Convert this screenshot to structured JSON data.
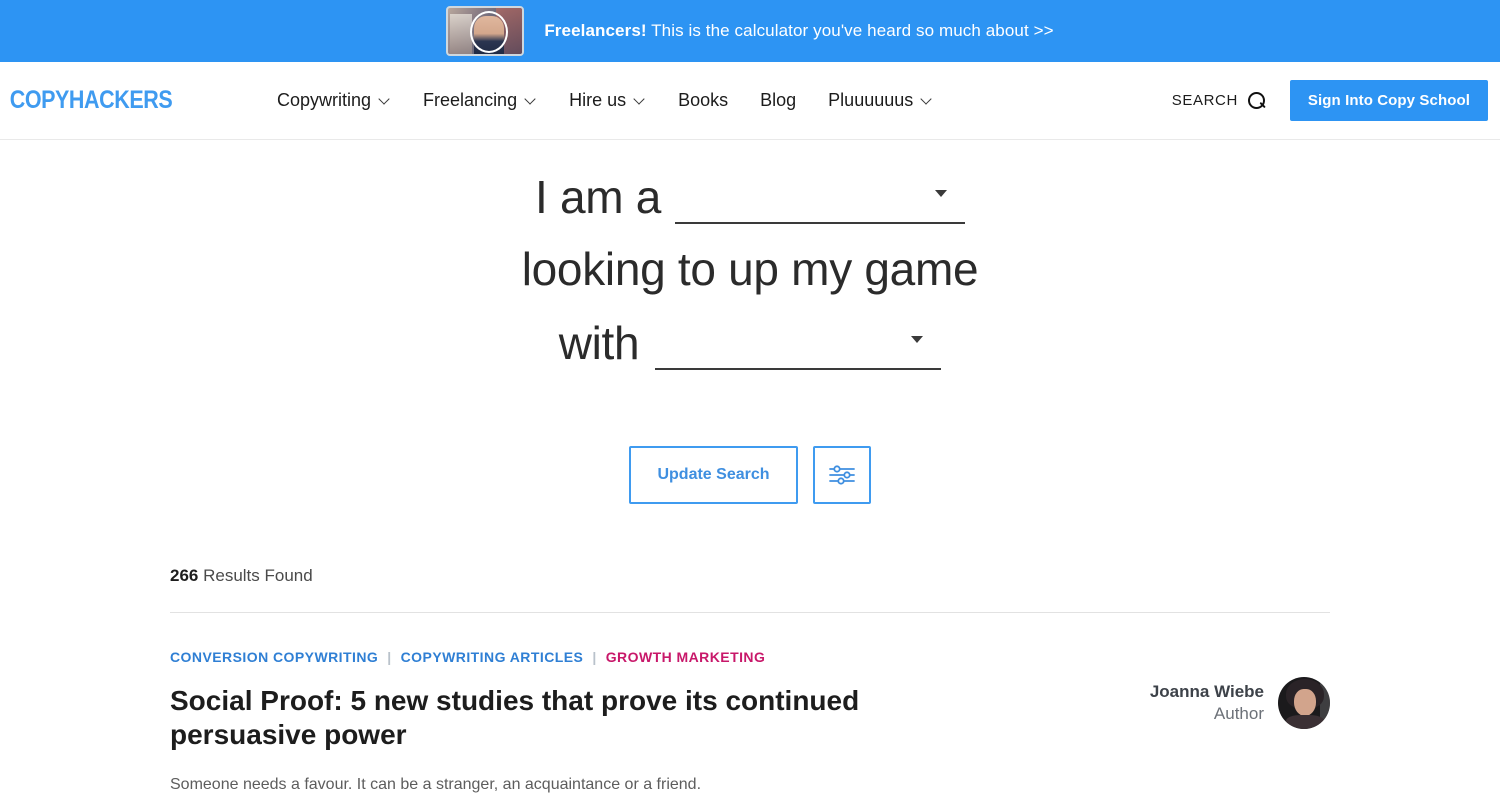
{
  "promo": {
    "strong": "Freelancers!",
    "text": " This is the calculator you've heard so much about >>",
    "thumbnail_name": "video-thumbnail",
    "background_color": "#2d94f3"
  },
  "header": {
    "logo": "COPYHACKERS",
    "nav": [
      {
        "label": "Copywriting",
        "has_dropdown": true
      },
      {
        "label": "Freelancing",
        "has_dropdown": true
      },
      {
        "label": "Hire us",
        "has_dropdown": true
      },
      {
        "label": "Books",
        "has_dropdown": false
      },
      {
        "label": "Blog",
        "has_dropdown": false
      },
      {
        "label": "Pluuuuuus",
        "has_dropdown": true
      }
    ],
    "search_label": "SEARCH",
    "signin_label": "Sign Into Copy School",
    "accent_color": "#2d94f3"
  },
  "hero": {
    "line1_label": "I am a",
    "line1_value": "",
    "line2": "looking to up my game",
    "line3_label": "with",
    "line3_value": "",
    "update_button": "Update Search",
    "filter_button_name": "filter-sliders"
  },
  "results": {
    "count": "266",
    "count_suffix": " Results Found",
    "posts": [
      {
        "categories": [
          {
            "label": "CONVERSION COPYWRITING",
            "color": "blue"
          },
          {
            "label": "COPYWRITING ARTICLES",
            "color": "blue"
          },
          {
            "label": "GROWTH MARKETING",
            "color": "pink"
          }
        ],
        "separator": "|",
        "title": "Social Proof: 5 new studies that prove its continued persuasive power",
        "excerpt": "Someone needs a favour. It can be a stranger, an acquaintance or a friend.",
        "author_name": "Joanna Wiebe",
        "author_role": "Author"
      }
    ]
  }
}
